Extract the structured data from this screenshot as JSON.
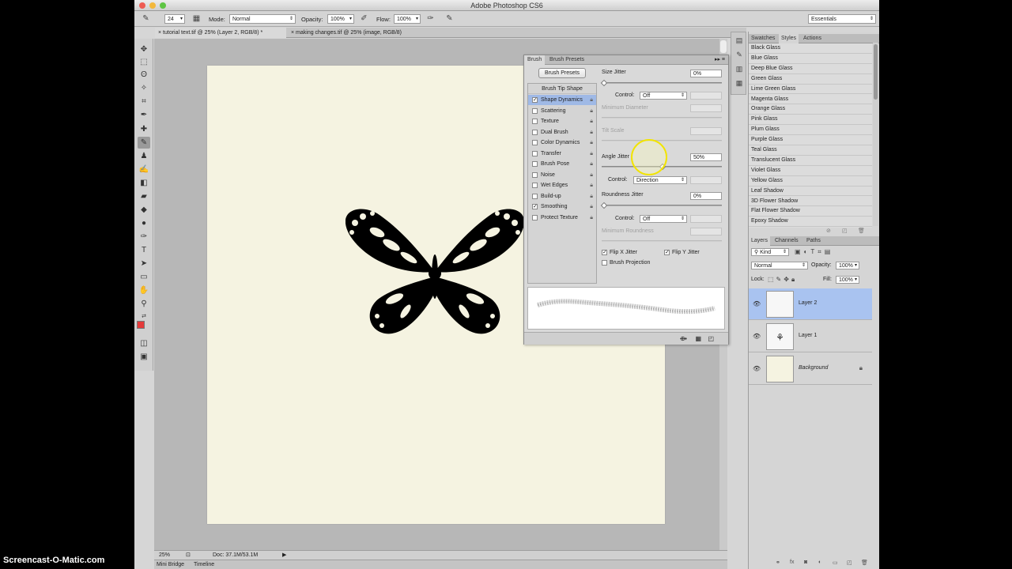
{
  "window": {
    "title": "Adobe Photoshop CS6"
  },
  "options_bar": {
    "brush_size": "24",
    "mode_label": "Mode:",
    "mode_value": "Normal",
    "opacity_label": "Opacity:",
    "opacity_value": "100%",
    "flow_label": "Flow:",
    "flow_value": "100%",
    "workspace": "Essentials"
  },
  "doc_tabs": [
    {
      "label": "tutorial text.tif @ 25% (Layer 2, RGB/8) *"
    },
    {
      "label": "making changes.tif @ 25% (image, RGB/8)"
    }
  ],
  "status": {
    "zoom": "25%",
    "doc": "Doc: 37.1M/53.1M"
  },
  "bottom_tabs": [
    "Mini Bridge",
    "Timeline"
  ],
  "brush_panel": {
    "tabs": [
      "Brush",
      "Brush Presets"
    ],
    "presets_button": "Brush Presets",
    "list_header": "Brush Tip Shape",
    "items": [
      {
        "label": "Shape Dynamics",
        "checked": true
      },
      {
        "label": "Scattering",
        "checked": false
      },
      {
        "label": "Texture",
        "checked": false
      },
      {
        "label": "Dual Brush",
        "checked": false
      },
      {
        "label": "Color Dynamics",
        "checked": false
      },
      {
        "label": "Transfer",
        "checked": false
      },
      {
        "label": "Brush Pose",
        "checked": false
      },
      {
        "label": "Noise",
        "checked": false
      },
      {
        "label": "Wet Edges",
        "checked": false
      },
      {
        "label": "Build-up",
        "checked": false
      },
      {
        "label": "Smoothing",
        "checked": true
      },
      {
        "label": "Protect Texture",
        "checked": false
      }
    ],
    "size_jitter": {
      "label": "Size Jitter",
      "value": "0%"
    },
    "control_label": "Control:",
    "size_control": "Off",
    "min_diameter": "Minimum Diameter",
    "tilt_scale": "Tilt Scale",
    "angle_jitter": {
      "label": "Angle Jitter",
      "value": "50%"
    },
    "angle_control": "Direction",
    "roundness_jitter": {
      "label": "Roundness Jitter",
      "value": "0%"
    },
    "roundness_control": "Off",
    "min_roundness": "Minimum Roundness",
    "flip_x": "Flip X Jitter",
    "flip_y": "Flip Y Jitter",
    "projection": "Brush Projection"
  },
  "styles_panel": {
    "tabs": [
      "Swatches",
      "Styles",
      "Actions"
    ],
    "items": [
      "Black Glass",
      "Blue Glass",
      "Deep Blue Glass",
      "Green Glass",
      "Lime Green Glass",
      "Magenta Glass",
      "Orange Glass",
      "Pink Glass",
      "Plum Glass",
      "Purple Glass",
      "Teal Glass",
      "Translucent Glass",
      "Violet Glass",
      "Yellow Glass",
      "Leaf Shadow",
      "3D Flower Shadow",
      "Flat Flower Shadow",
      "Epoxy Shadow"
    ]
  },
  "layers_panel": {
    "tabs": [
      "Layers",
      "Channels",
      "Paths"
    ],
    "kind": "Kind",
    "blend": "Normal",
    "opacity_label": "Opacity:",
    "opacity_value": "100%",
    "lock_label": "Lock:",
    "fill_label": "Fill:",
    "fill_value": "100%",
    "layers": [
      {
        "name": "Layer 2",
        "active": true
      },
      {
        "name": "Layer 1",
        "active": false
      },
      {
        "name": "Background",
        "active": false
      }
    ]
  },
  "watermark": "Screencast-O-Matic.com",
  "colors": {
    "foreground": "#e53b3b",
    "background": "#ffffff",
    "canvas": "#f5f3e1",
    "selection": "#a9c3f0"
  }
}
